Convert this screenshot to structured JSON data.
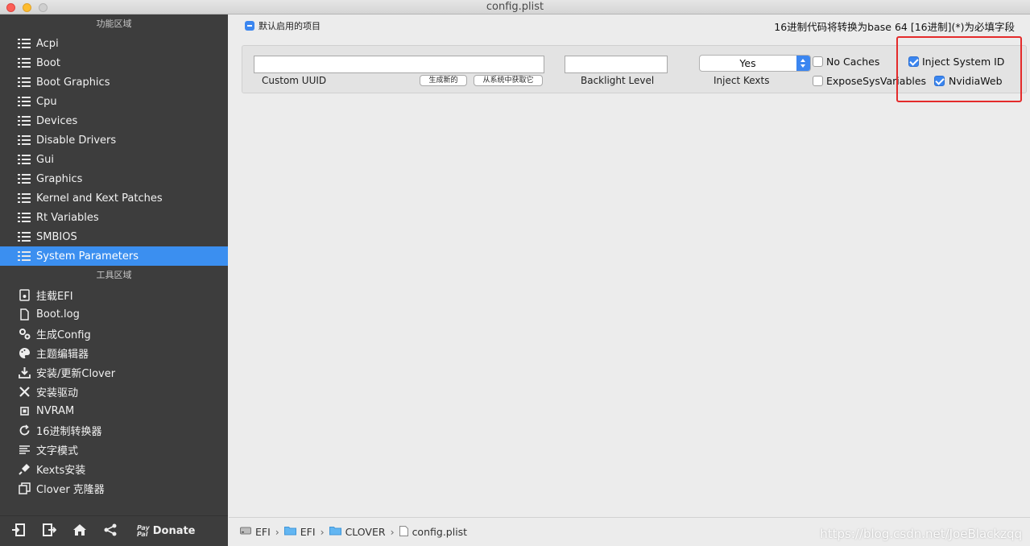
{
  "window": {
    "title": "config.plist"
  },
  "sidebar": {
    "section_functions": "功能区域",
    "items": [
      {
        "label": "Acpi",
        "icon": "list-icon"
      },
      {
        "label": "Boot",
        "icon": "list-icon"
      },
      {
        "label": "Boot Graphics",
        "icon": "list-icon"
      },
      {
        "label": "Cpu",
        "icon": "list-icon"
      },
      {
        "label": "Devices",
        "icon": "list-icon"
      },
      {
        "label": "Disable Drivers",
        "icon": "list-icon"
      },
      {
        "label": "Gui",
        "icon": "list-icon"
      },
      {
        "label": "Graphics",
        "icon": "list-icon"
      },
      {
        "label": "Kernel and Kext Patches",
        "icon": "list-icon"
      },
      {
        "label": "Rt Variables",
        "icon": "list-icon"
      },
      {
        "label": "SMBIOS",
        "icon": "list-icon"
      },
      {
        "label": "System Parameters",
        "icon": "list-icon",
        "active": true
      }
    ],
    "section_tools": "工具区域",
    "tools": [
      {
        "label": "挂载EFI",
        "icon": "disk-icon"
      },
      {
        "label": "Boot.log",
        "icon": "document-icon"
      },
      {
        "label": "生成Config",
        "icon": "gears-icon"
      },
      {
        "label": "主题编辑器",
        "icon": "palette-icon"
      },
      {
        "label": "安装/更新Clover",
        "icon": "download-icon"
      },
      {
        "label": "安装驱动",
        "icon": "tools-icon"
      },
      {
        "label": "NVRAM",
        "icon": "chip-icon"
      },
      {
        "label": "16进制转换器",
        "icon": "refresh-icon"
      },
      {
        "label": "文字模式",
        "icon": "text-icon"
      },
      {
        "label": "Kexts安装",
        "icon": "plug-icon"
      },
      {
        "label": "Clover 克隆器",
        "icon": "clone-icon"
      }
    ],
    "footer": {
      "donate_label": "Donate",
      "paypal_top": "Pay",
      "paypal_bottom": "Pal"
    }
  },
  "main": {
    "default_enabled_label": "默认启用的项目",
    "note": "16进制代码将转换为base 64 [16进制](*)为必填字段",
    "custom_uuid": {
      "label": "Custom UUID",
      "value": "",
      "generate_button": "生成新的",
      "from_system_button": "从系统中获取它"
    },
    "backlight_level": {
      "label": "Backlight Level",
      "value": ""
    },
    "inject_kexts": {
      "label": "Inject Kexts",
      "value": "Yes"
    },
    "checkboxes": {
      "no_caches": {
        "label": "No Caches",
        "checked": false
      },
      "expose_sys_variables": {
        "label": "ExposeSysVariables",
        "checked": false
      },
      "inject_system_id": {
        "label": "Inject System ID",
        "checked": true
      },
      "nvidia_web": {
        "label": "NvidiaWeb",
        "checked": true
      }
    },
    "highlight_color": "#e42b2b",
    "accent_color": "#3b86f0"
  },
  "pathbar": {
    "crumbs": [
      "EFI",
      "EFI",
      "CLOVER",
      "config.plist"
    ],
    "separator": "›"
  },
  "watermark": "https://blog.csdn.net/JoeBlackzqq"
}
